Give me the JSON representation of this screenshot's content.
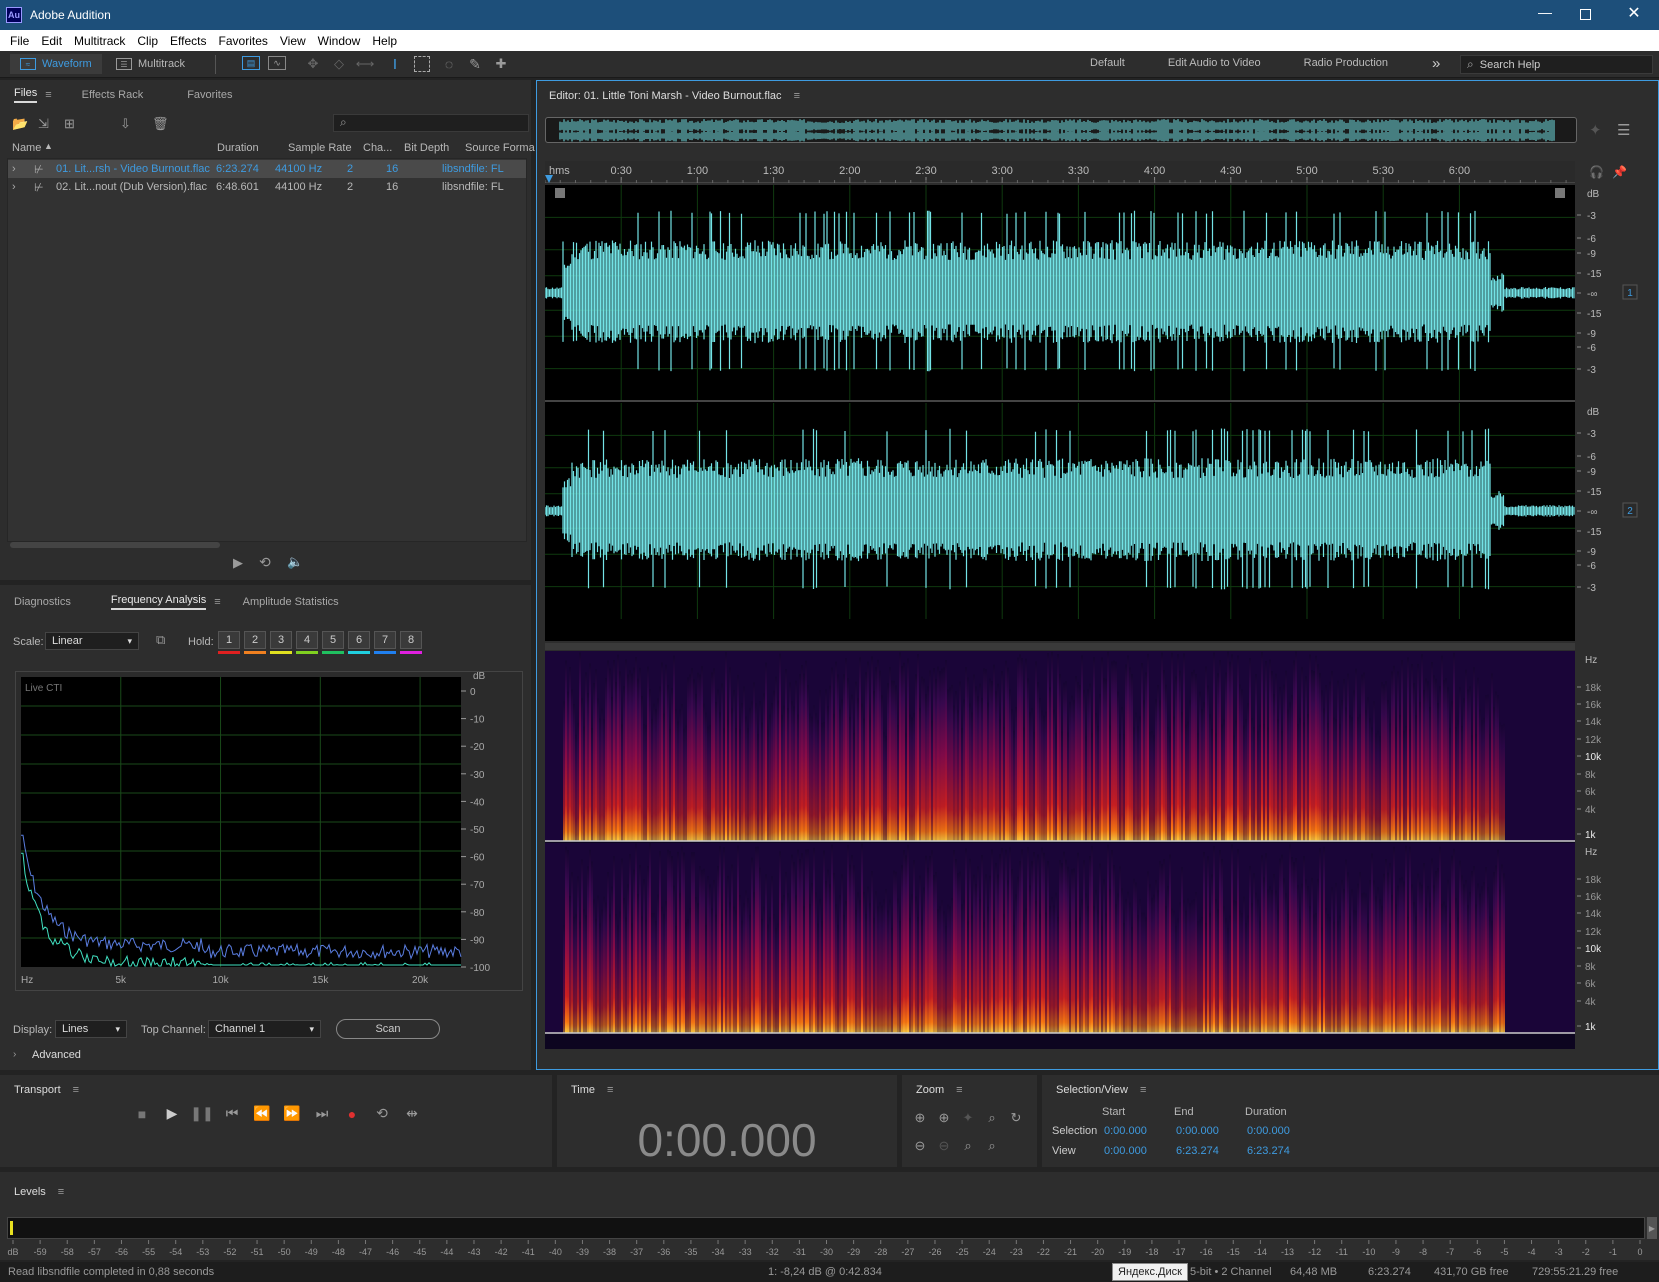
{
  "app": {
    "title": "Adobe Audition",
    "logo": "Au"
  },
  "menu": [
    "File",
    "Edit",
    "Multitrack",
    "Clip",
    "Effects",
    "Favorites",
    "View",
    "Window",
    "Help"
  ],
  "toolbar": {
    "waveform_label": "Waveform",
    "multitrack_label": "Multitrack",
    "workspaces": [
      "Default",
      "Edit Audio to Video",
      "Radio Production"
    ],
    "more_label": "»",
    "search_placeholder": "Search Help"
  },
  "files_panel": {
    "tabs": [
      "Files",
      "Effects Rack",
      "Favorites"
    ],
    "columns": [
      "Name",
      "Duration",
      "Sample Rate",
      "Cha...",
      "Bit Depth",
      "Source Forma"
    ],
    "rows": [
      {
        "name": "01. Lit...rsh - Video Burnout.flac",
        "duration": "6:23.274",
        "rate": "44100 Hz",
        "ch": "2",
        "bits": "16",
        "format": "libsndfile: FL",
        "selected": true
      },
      {
        "name": "02. Lit...nout (Dub Version).flac",
        "duration": "6:48.601",
        "rate": "44100 Hz",
        "ch": "2",
        "bits": "16",
        "format": "libsndfile: FL",
        "selected": false
      }
    ]
  },
  "freq_panel": {
    "tabs": [
      "Diagnostics",
      "Frequency Analysis",
      "Amplitude Statistics"
    ],
    "scale_label": "Scale:",
    "scale_value": "Linear",
    "hold_label": "Hold:",
    "hold_buttons": [
      "1",
      "2",
      "3",
      "4",
      "5",
      "6",
      "7",
      "8"
    ],
    "hold_colors": [
      "#e02020",
      "#f08020",
      "#e0e020",
      "#80d020",
      "#20c060",
      "#20d0e0",
      "#2080f0",
      "#e020e0"
    ],
    "live_label": "Live CTI",
    "db_label": "dB",
    "db_ticks": [
      "0",
      "-10",
      "-20",
      "-30",
      "-40",
      "-50",
      "-60",
      "-70",
      "-80",
      "-90",
      "-100"
    ],
    "hz_ticks": [
      "Hz",
      "5k",
      "10k",
      "15k",
      "20k"
    ],
    "display_label": "Display:",
    "display_value": "Lines",
    "top_channel_label": "Top Channel:",
    "top_channel_value": "Channel 1",
    "scan_label": "Scan",
    "advanced_label": "Advanced"
  },
  "editor": {
    "title": "Editor: 01. Little Toni Marsh - Video Burnout.flac",
    "ruler": [
      "hms",
      "0:30",
      "1:00",
      "1:30",
      "2:00",
      "2:30",
      "3:00",
      "3:30",
      "4:00",
      "4:30",
      "5:00",
      "5:30",
      "6:00"
    ],
    "db_label": "dB",
    "db_scale": [
      "-3",
      "-6",
      "-9",
      "-15",
      "-∞",
      "-15",
      "-9",
      "-6",
      "-3"
    ],
    "channels": [
      "1",
      "2"
    ],
    "hz_label": "Hz",
    "hz_scale": [
      "18k",
      "16k",
      "14k",
      "12k",
      "10k",
      "8k",
      "6k",
      "4k",
      "1k"
    ]
  },
  "transport": {
    "title": "Transport"
  },
  "time": {
    "title": "Time",
    "value": "0:00.000"
  },
  "zoom": {
    "title": "Zoom"
  },
  "selection": {
    "title": "Selection/View",
    "headers": [
      "Start",
      "End",
      "Duration"
    ],
    "rows": [
      {
        "label": "Selection",
        "start": "0:00.000",
        "end": "0:00.000",
        "duration": "0:00.000"
      },
      {
        "label": "View",
        "start": "0:00.000",
        "end": "6:23.274",
        "duration": "6:23.274"
      }
    ]
  },
  "levels": {
    "title": "Levels",
    "scale": [
      "dB",
      "-59",
      "-58",
      "-57",
      "-56",
      "-55",
      "-54",
      "-53",
      "-52",
      "-51",
      "-50",
      "-49",
      "-48",
      "-47",
      "-46",
      "-45",
      "-44",
      "-43",
      "-42",
      "-41",
      "-40",
      "-39",
      "-38",
      "-37",
      "-36",
      "-35",
      "-34",
      "-33",
      "-32",
      "-31",
      "-30",
      "-29",
      "-28",
      "-27",
      "-26",
      "-25",
      "-24",
      "-23",
      "-22",
      "-21",
      "-20",
      "-19",
      "-18",
      "-17",
      "-16",
      "-15",
      "-14",
      "-13",
      "-12",
      "-11",
      "-10",
      "-9",
      "-8",
      "-7",
      "-6",
      "-5",
      "-4",
      "-3",
      "-2",
      "-1",
      "0"
    ]
  },
  "status": {
    "left": "Read libsndfile completed in 0,88 seconds",
    "cursor": "1: -8,24 dB @ 0:42.834",
    "tooltip": "Яндекс.Диск",
    "format": "5-bit • 2 Channel",
    "size": "64,48 MB",
    "duration": "6:23.274",
    "free": "431,70 GB free",
    "free_time": "729:55:21.29 free"
  },
  "colors": {
    "accent": "#3e9be0",
    "waveform": "#73e3e6",
    "titlebar": "#1d4f7a"
  }
}
